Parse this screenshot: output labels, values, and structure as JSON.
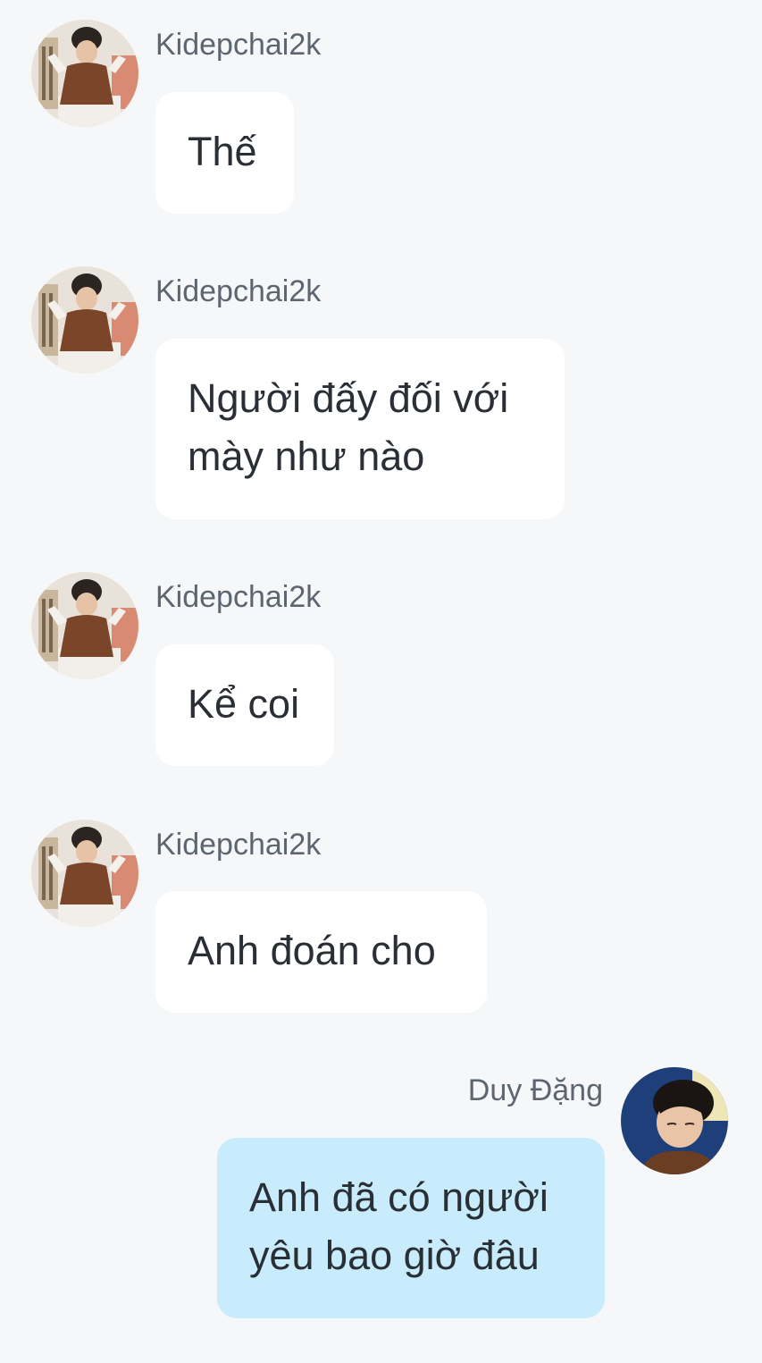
{
  "messages": [
    {
      "sender": "Kidepchai2k",
      "avatar_icon": "user-avatar-kidepchai2k",
      "lines": [
        "Thế"
      ],
      "outgoing": false
    },
    {
      "sender": "Kidepchai2k",
      "avatar_icon": "user-avatar-kidepchai2k",
      "lines": [
        "Người đấy đối với",
        "mày như nào"
      ],
      "outgoing": false
    },
    {
      "sender": "Kidepchai2k",
      "avatar_icon": "user-avatar-kidepchai2k",
      "lines": [
        "Kể coi"
      ],
      "outgoing": false
    },
    {
      "sender": "Kidepchai2k",
      "avatar_icon": "user-avatar-kidepchai2k",
      "lines": [
        "Anh đoán cho"
      ],
      "outgoing": false
    },
    {
      "sender": "Duy Đặng",
      "avatar_icon": "user-avatar-duy-dang",
      "lines": [
        "Anh đã có người",
        "yêu bao giờ đâu"
      ],
      "outgoing": true
    }
  ],
  "colors": {
    "background": "#f6f7f9",
    "incoming_bubble": "#ffffff",
    "outgoing_bubble": "#c8ecfb",
    "sender_text": "#5d6670",
    "message_text": "#2a2f36"
  }
}
